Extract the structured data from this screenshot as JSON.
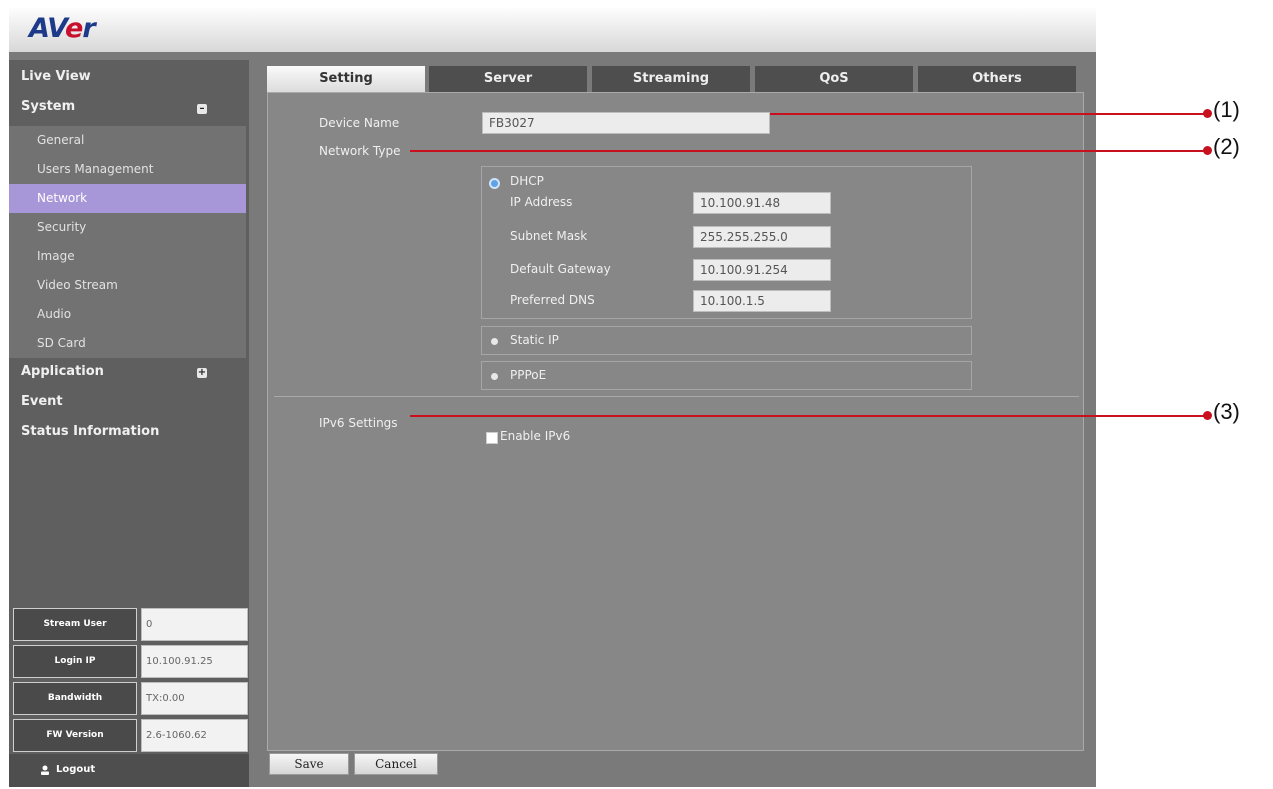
{
  "header": {
    "logo_left": "AV",
    "logo_e": "e",
    "logo_right": "r"
  },
  "sidebar": {
    "top_items": [
      {
        "label": "Live View"
      },
      {
        "label": "System",
        "toggle": "–"
      },
      {
        "label": "Application",
        "toggle": "+"
      },
      {
        "label": "Event"
      },
      {
        "label": "Status Information"
      }
    ],
    "system_items": [
      "General",
      "Users Management",
      "Network",
      "Security",
      "Image",
      "Video Stream",
      "Audio",
      "SD Card"
    ],
    "active_item": "Network",
    "info": [
      {
        "label": "Stream User",
        "value": "0"
      },
      {
        "label": "Login IP",
        "value": "10.100.91.25"
      },
      {
        "label": "Bandwidth",
        "value": "TX:0.00"
      },
      {
        "label": "FW Version",
        "value": "2.6-1060.62"
      }
    ],
    "logout_label": "Logout"
  },
  "tabs": [
    "Setting",
    "Server",
    "Streaming",
    "QoS",
    "Others"
  ],
  "active_tab": "Setting",
  "form": {
    "device_name_label": "Device Name",
    "device_name_value": "FB3027",
    "network_type_label": "Network Type",
    "dhcp_label": "DHCP",
    "ip_address_label": "IP Address",
    "ip_address_value": "10.100.91.48",
    "subnet_mask_label": "Subnet Mask",
    "subnet_mask_value": "255.255.255.0",
    "default_gateway_label": "Default Gateway",
    "default_gateway_value": "10.100.91.254",
    "preferred_dns_label": "Preferred DNS",
    "preferred_dns_value": "10.100.1.5",
    "static_ip_label": "Static IP",
    "pppoe_label": "PPPoE",
    "ipv6_settings_label": "IPv6 Settings",
    "enable_ipv6_label": "Enable IPv6"
  },
  "buttons": {
    "save": "Save",
    "cancel": "Cancel"
  },
  "callouts": [
    "(1)",
    "(2)",
    "(3)"
  ],
  "colors": {
    "callout_red": "#c8101f",
    "active_nav": "#a897d8",
    "logo_blue": "#1d3a8a",
    "logo_red": "#c8102e"
  }
}
